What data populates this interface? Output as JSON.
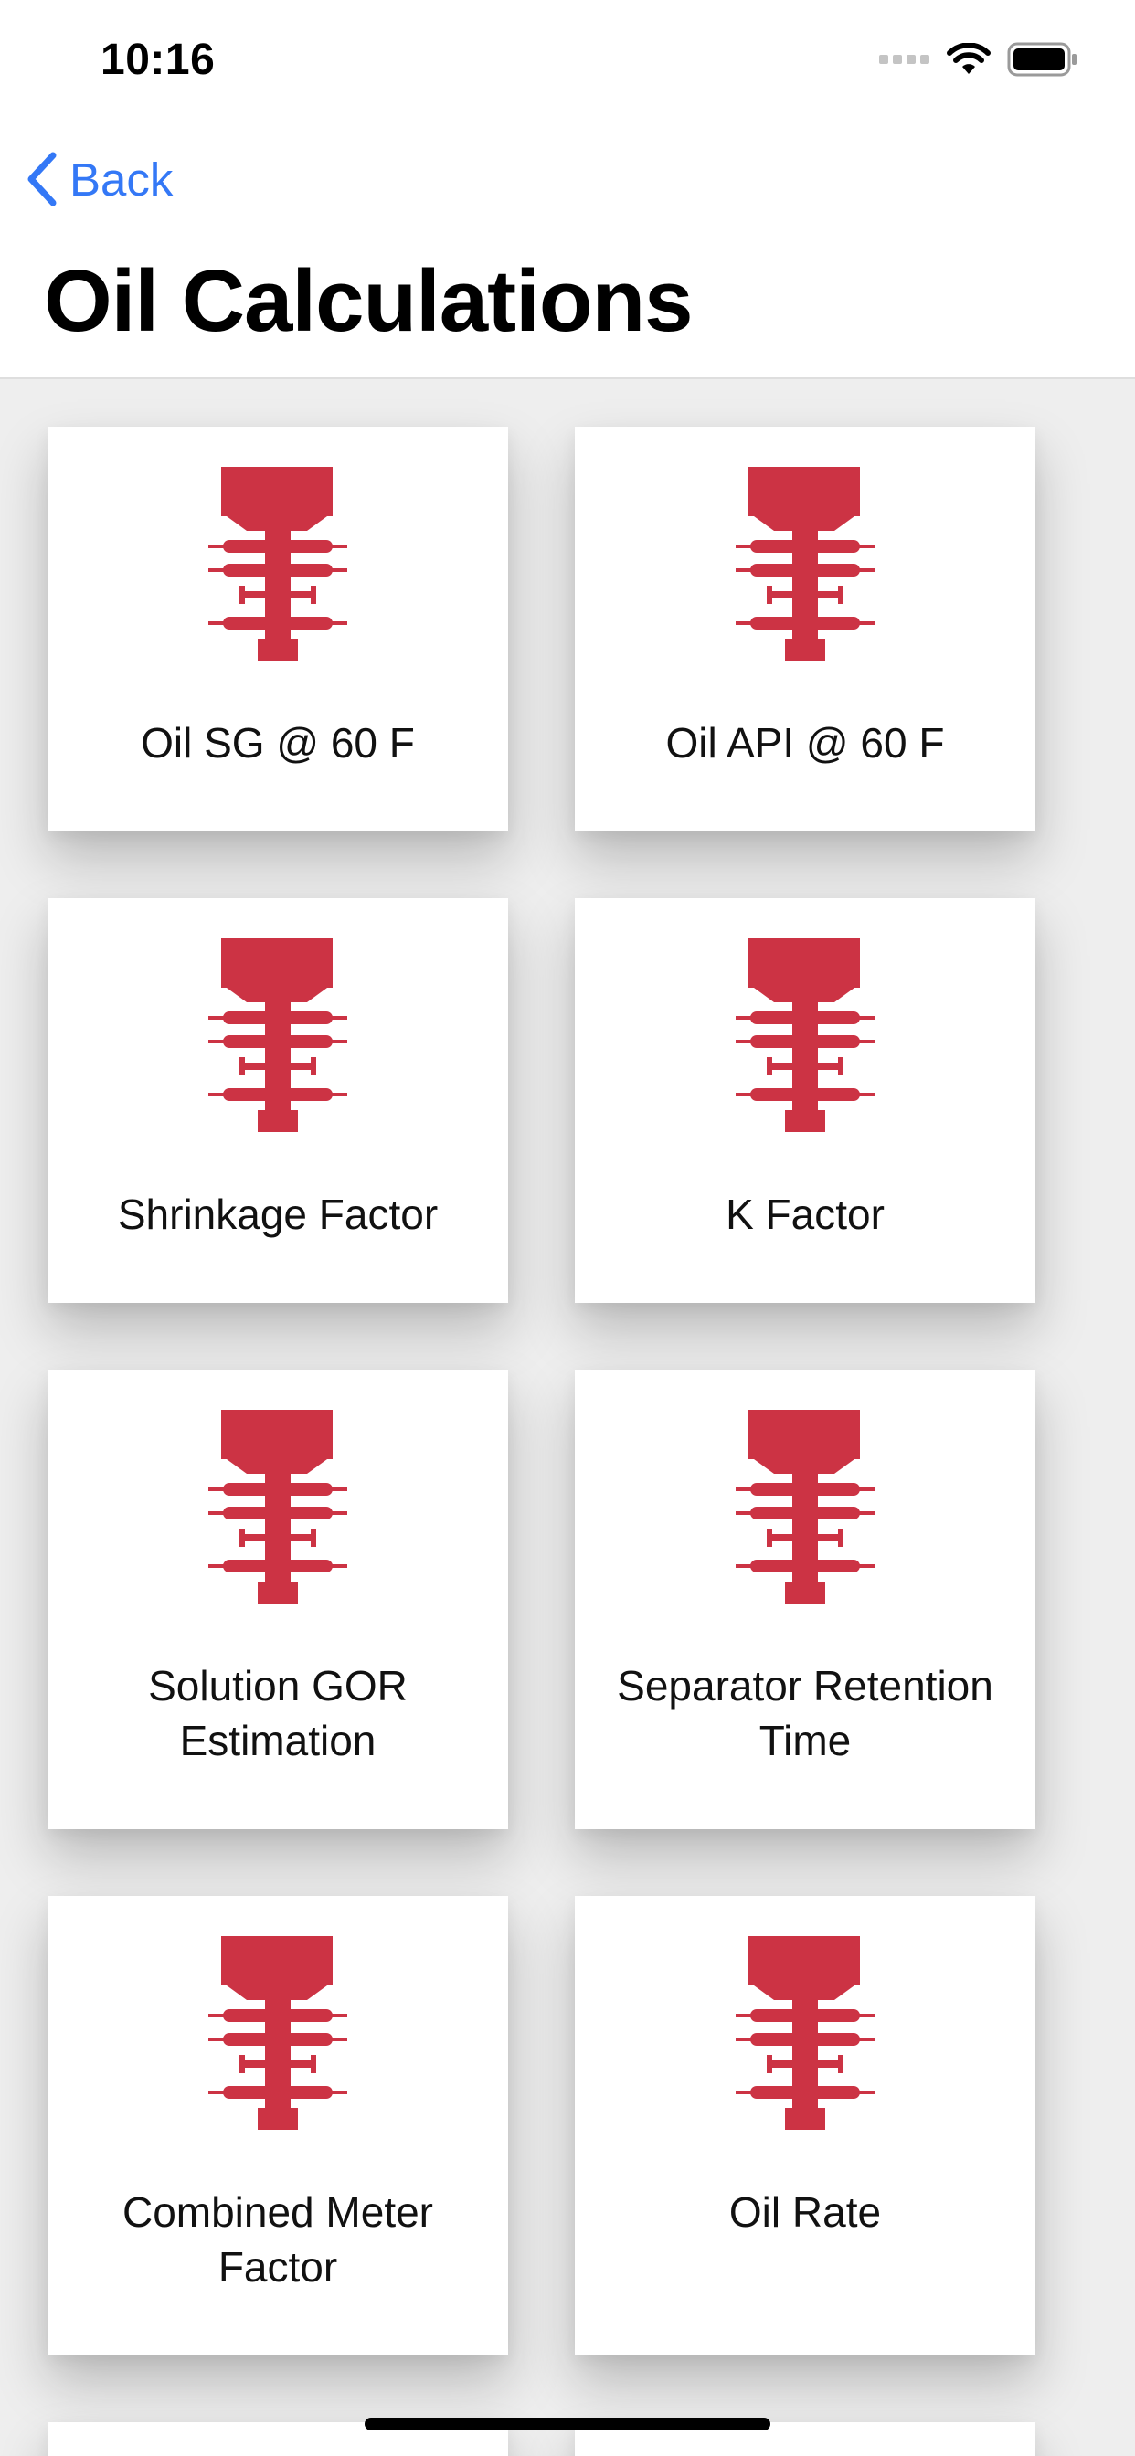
{
  "status_bar": {
    "time": "10:16"
  },
  "nav": {
    "back_label": "Back",
    "title": "Oil Calculations"
  },
  "colors": {
    "accent": "#3478f6",
    "icon_red": "#cc3344",
    "grid_bg": "#eeeeee"
  },
  "icon_name": "wellhead-icon",
  "items": [
    {
      "label": "Oil SG @ 60 F"
    },
    {
      "label": "Oil API @ 60 F"
    },
    {
      "label": "Shrinkage Factor"
    },
    {
      "label": "K Factor"
    },
    {
      "label": "Solution GOR Estimation"
    },
    {
      "label": "Separator Retention Time"
    },
    {
      "label": "Combined Meter Factor"
    },
    {
      "label": "Oil Rate"
    }
  ]
}
